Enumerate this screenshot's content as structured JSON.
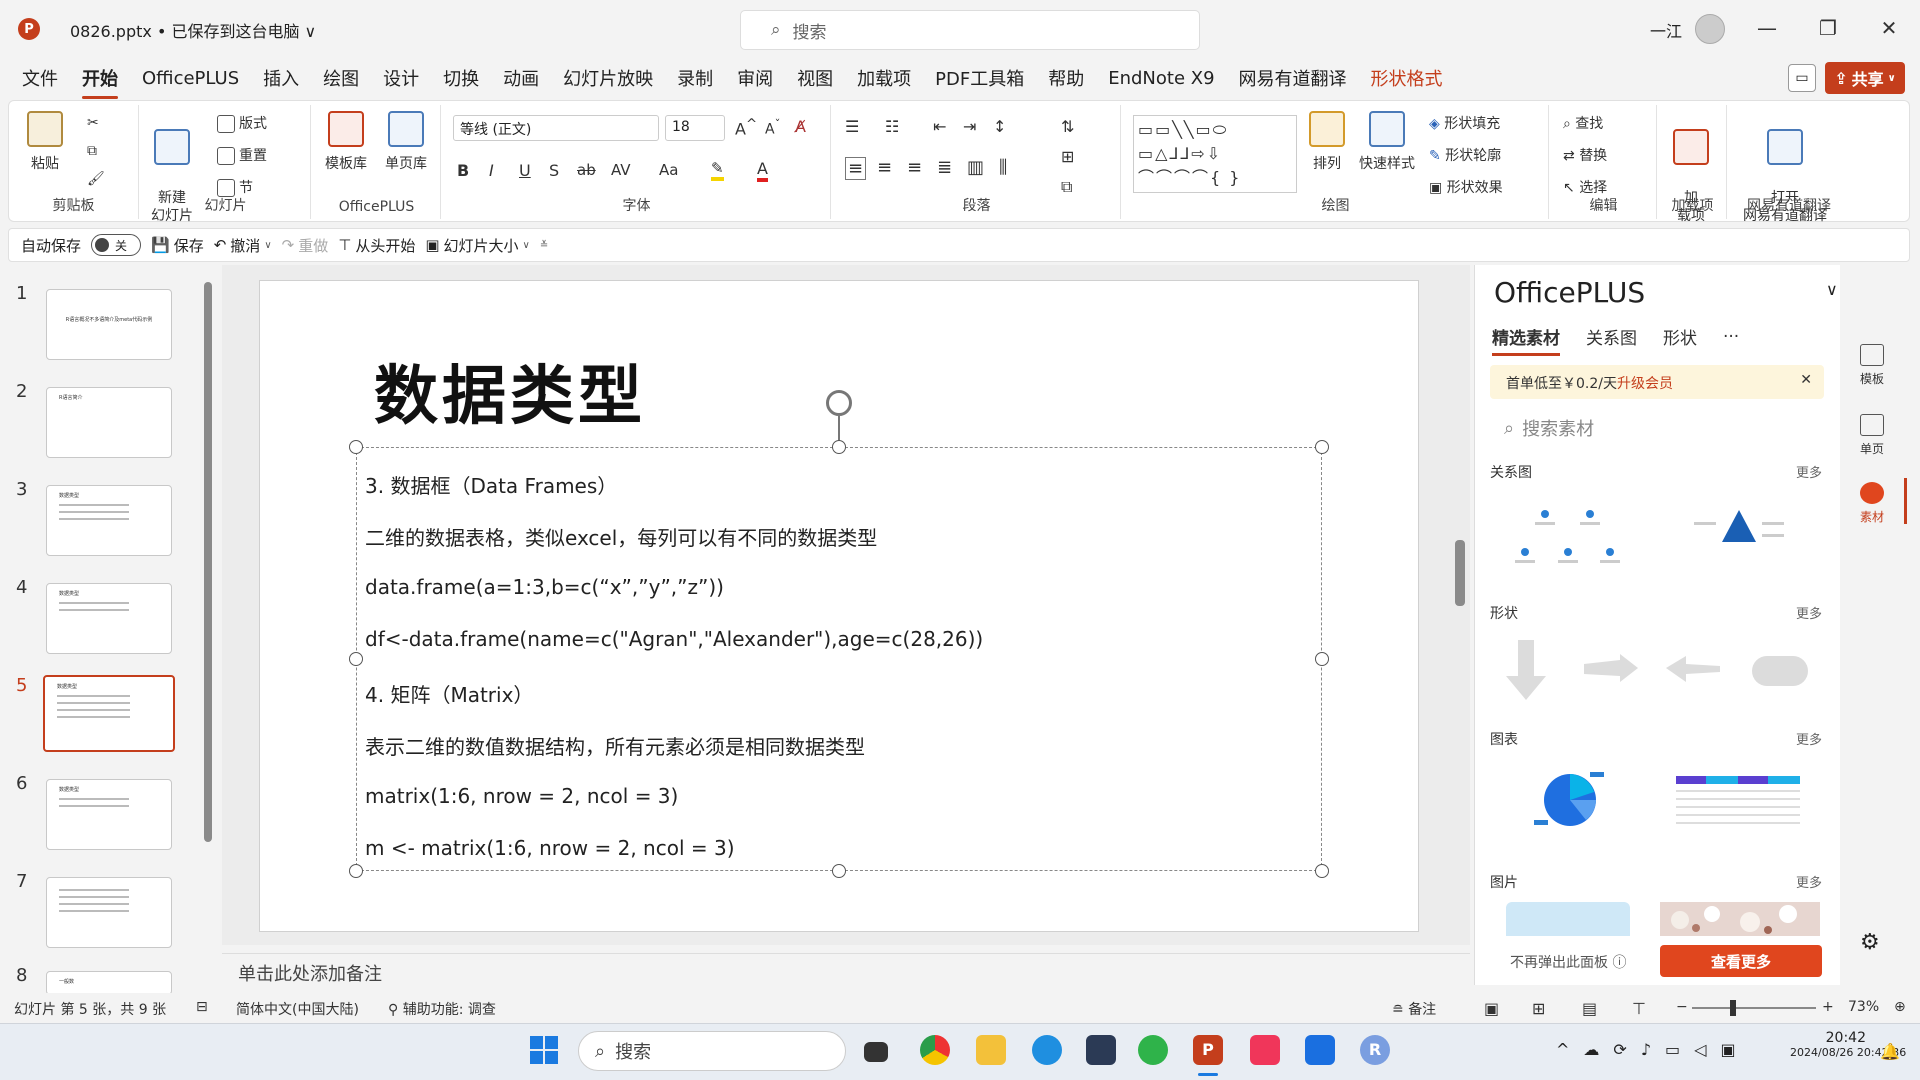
{
  "titlebar": {
    "app_logo": "P",
    "doc_title": "0826.pptx • 已保存到这台电脑 ∨",
    "search_placeholder": "搜索",
    "user_name": "一江",
    "minimize": "—",
    "restore": "❐",
    "close": "✕"
  },
  "menu": {
    "items": [
      "文件",
      "开始",
      "OfficePLUS",
      "插入",
      "绘图",
      "设计",
      "切换",
      "动画",
      "幻灯片放映",
      "录制",
      "审阅",
      "视图",
      "加载项",
      "PDF工具箱",
      "帮助",
      "EndNote X9",
      "网易有道翻译",
      "形状格式"
    ],
    "active": "开始",
    "accent": "形状格式",
    "share": "共享"
  },
  "ribbon": {
    "clipboard": {
      "label": "剪贴板",
      "paste": "粘贴"
    },
    "slides": {
      "label": "幻灯片",
      "new_slide": "新建\n幻灯片",
      "layout": "版式",
      "reset": "重置",
      "section": "节"
    },
    "officeplus": {
      "label": "OfficePLUS",
      "template": "模板库",
      "single": "单页库"
    },
    "font": {
      "label": "字体",
      "family": "等线 (正文)",
      "size": "18",
      "bold": "B",
      "italic": "I",
      "underline": "U",
      "shadow": "S",
      "strike": "ab",
      "spacing": "AV",
      "case": "Aa"
    },
    "paragraph": {
      "label": "段落"
    },
    "drawing": {
      "label": "绘图",
      "arrange": "排列",
      "quick_style": "快速样式",
      "fill": "形状填充",
      "outline": "形状轮廓",
      "effect": "形状效果"
    },
    "editing": {
      "label": "编辑",
      "find": "查找",
      "replace": "替换",
      "select": "选择"
    },
    "addins": {
      "label": "加载项",
      "addin": "加\n载项"
    },
    "youdao": {
      "label": "网易有道翻译",
      "open": "打开\n网易有道翻译"
    }
  },
  "qat": {
    "autosave": "自动保存",
    "toggle": "关",
    "save": "保存",
    "undo": "撤消",
    "redo": "重做",
    "from_start": "从头开始",
    "slide_size": "幻灯片大小"
  },
  "thumbnails": [
    {
      "num": "1",
      "title": "R语言概况不多语简介及meta代码示例"
    },
    {
      "num": "2",
      "title": "R语言简介"
    },
    {
      "num": "3",
      "title": "数据类型"
    },
    {
      "num": "4",
      "title": "数据类型"
    },
    {
      "num": "5",
      "title": "数据类型"
    },
    {
      "num": "6",
      "title": "数据类型"
    },
    {
      "num": "7",
      "title": ""
    },
    {
      "num": "8",
      "title": "一般数"
    }
  ],
  "slide": {
    "title": "数据类型",
    "lines": [
      "3. 数据框（Data Frames）",
      "二维的数据表格，类似excel，每列可以有不同的数据类型",
      "data.frame(a=1:3,b=c(“x”,”y”,”z”))",
      "df<-data.frame(name=c(\"Agran\",\"Alexander\"),age=c(28,26))",
      "4. 矩阵（Matrix）",
      "表示二维的数值数据结构，所有元素必须是相同数据类型",
      "matrix(1:6, nrow = 2, ncol = 3)",
      "m <- matrix(1:6, nrow = 2, ncol = 3)"
    ]
  },
  "notes_placeholder": "单击此处添加备注",
  "panel": {
    "title": "OfficePLUS",
    "tabs": [
      "精选素材",
      "关系图",
      "形状",
      "···"
    ],
    "promo_text": "首单低至￥0.2/天",
    "promo_link": "升级会员",
    "search_placeholder": "搜索素材",
    "sections": [
      {
        "name": "关系图",
        "more": "更多"
      },
      {
        "name": "形状",
        "more": "更多"
      },
      {
        "name": "图表",
        "more": "更多"
      },
      {
        "name": "图片",
        "more": "更多"
      }
    ],
    "no_popup": "不再弹出此面板 ⓘ",
    "cta": "查看更多"
  },
  "rail": {
    "items": [
      "模板",
      "单页",
      "素材"
    ]
  },
  "status": {
    "slide_info": "幻灯片 第 5 张，共 9 张",
    "language": "简体中文(中国大陆)",
    "accessibility": "辅助功能: 调查",
    "notes": "备注",
    "zoom": "73%"
  },
  "taskbar": {
    "search": "搜索",
    "time": "20:42",
    "date": "2024/08/26 20:42:36"
  },
  "colors": {
    "accent": "#c43e1c",
    "cta": "#e0461e"
  }
}
